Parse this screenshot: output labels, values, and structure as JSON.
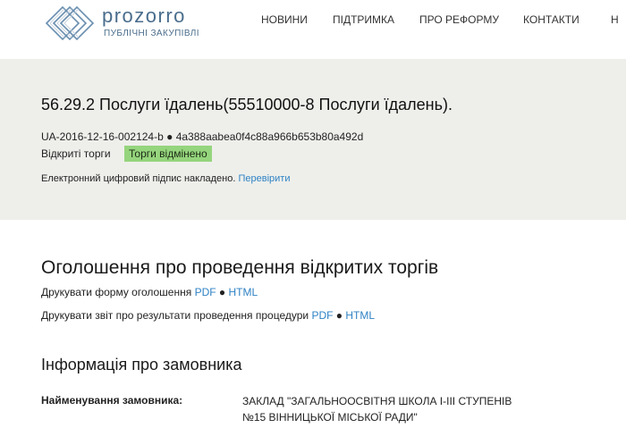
{
  "header": {
    "logo_word": "prozorro",
    "logo_sub": "ПУБЛІЧНІ ЗАКУПІВЛІ",
    "nav": [
      "НОВИНИ",
      "ПІДТРИМКА",
      "ПРО РЕФОРМУ",
      "КОНТАКТИ",
      "Н"
    ],
    "brand_color": "#4a6d8c"
  },
  "tender": {
    "title": "56.29.2 Послуги їдалень(55510000-8 Послуги їдалень).",
    "id": "UA-2016-12-16-002124-b",
    "separator": "●",
    "hash": "4a388aabea0f4c88a966b653b80a492d",
    "procedure_type": "Відкриті торги",
    "status": "Торги відмінено",
    "status_color": "#95d57d",
    "signature_text": "Електронний цифровий підпис накладено.",
    "signature_link": "Перевірити"
  },
  "announcement": {
    "title": "Оголошення про проведення відкритих торгів",
    "print_form_label": "Друкувати форму оголошення",
    "print_report_label": "Друкувати звіт про результати проведення процедури",
    "pdf": "PDF",
    "html": "HTML",
    "dot": "●",
    "link_color": "#2f82c4"
  },
  "customer": {
    "heading": "Інформація про замовника",
    "name_label": "Найменування замовника:",
    "name_value": "ЗАКЛАД \"ЗАГАЛЬНООСВІТНЯ ШКОЛА І-ІІІ СТУПЕНІВ №15 ВІННИЦЬКОЇ МІСЬКОЇ РАДИ\""
  }
}
